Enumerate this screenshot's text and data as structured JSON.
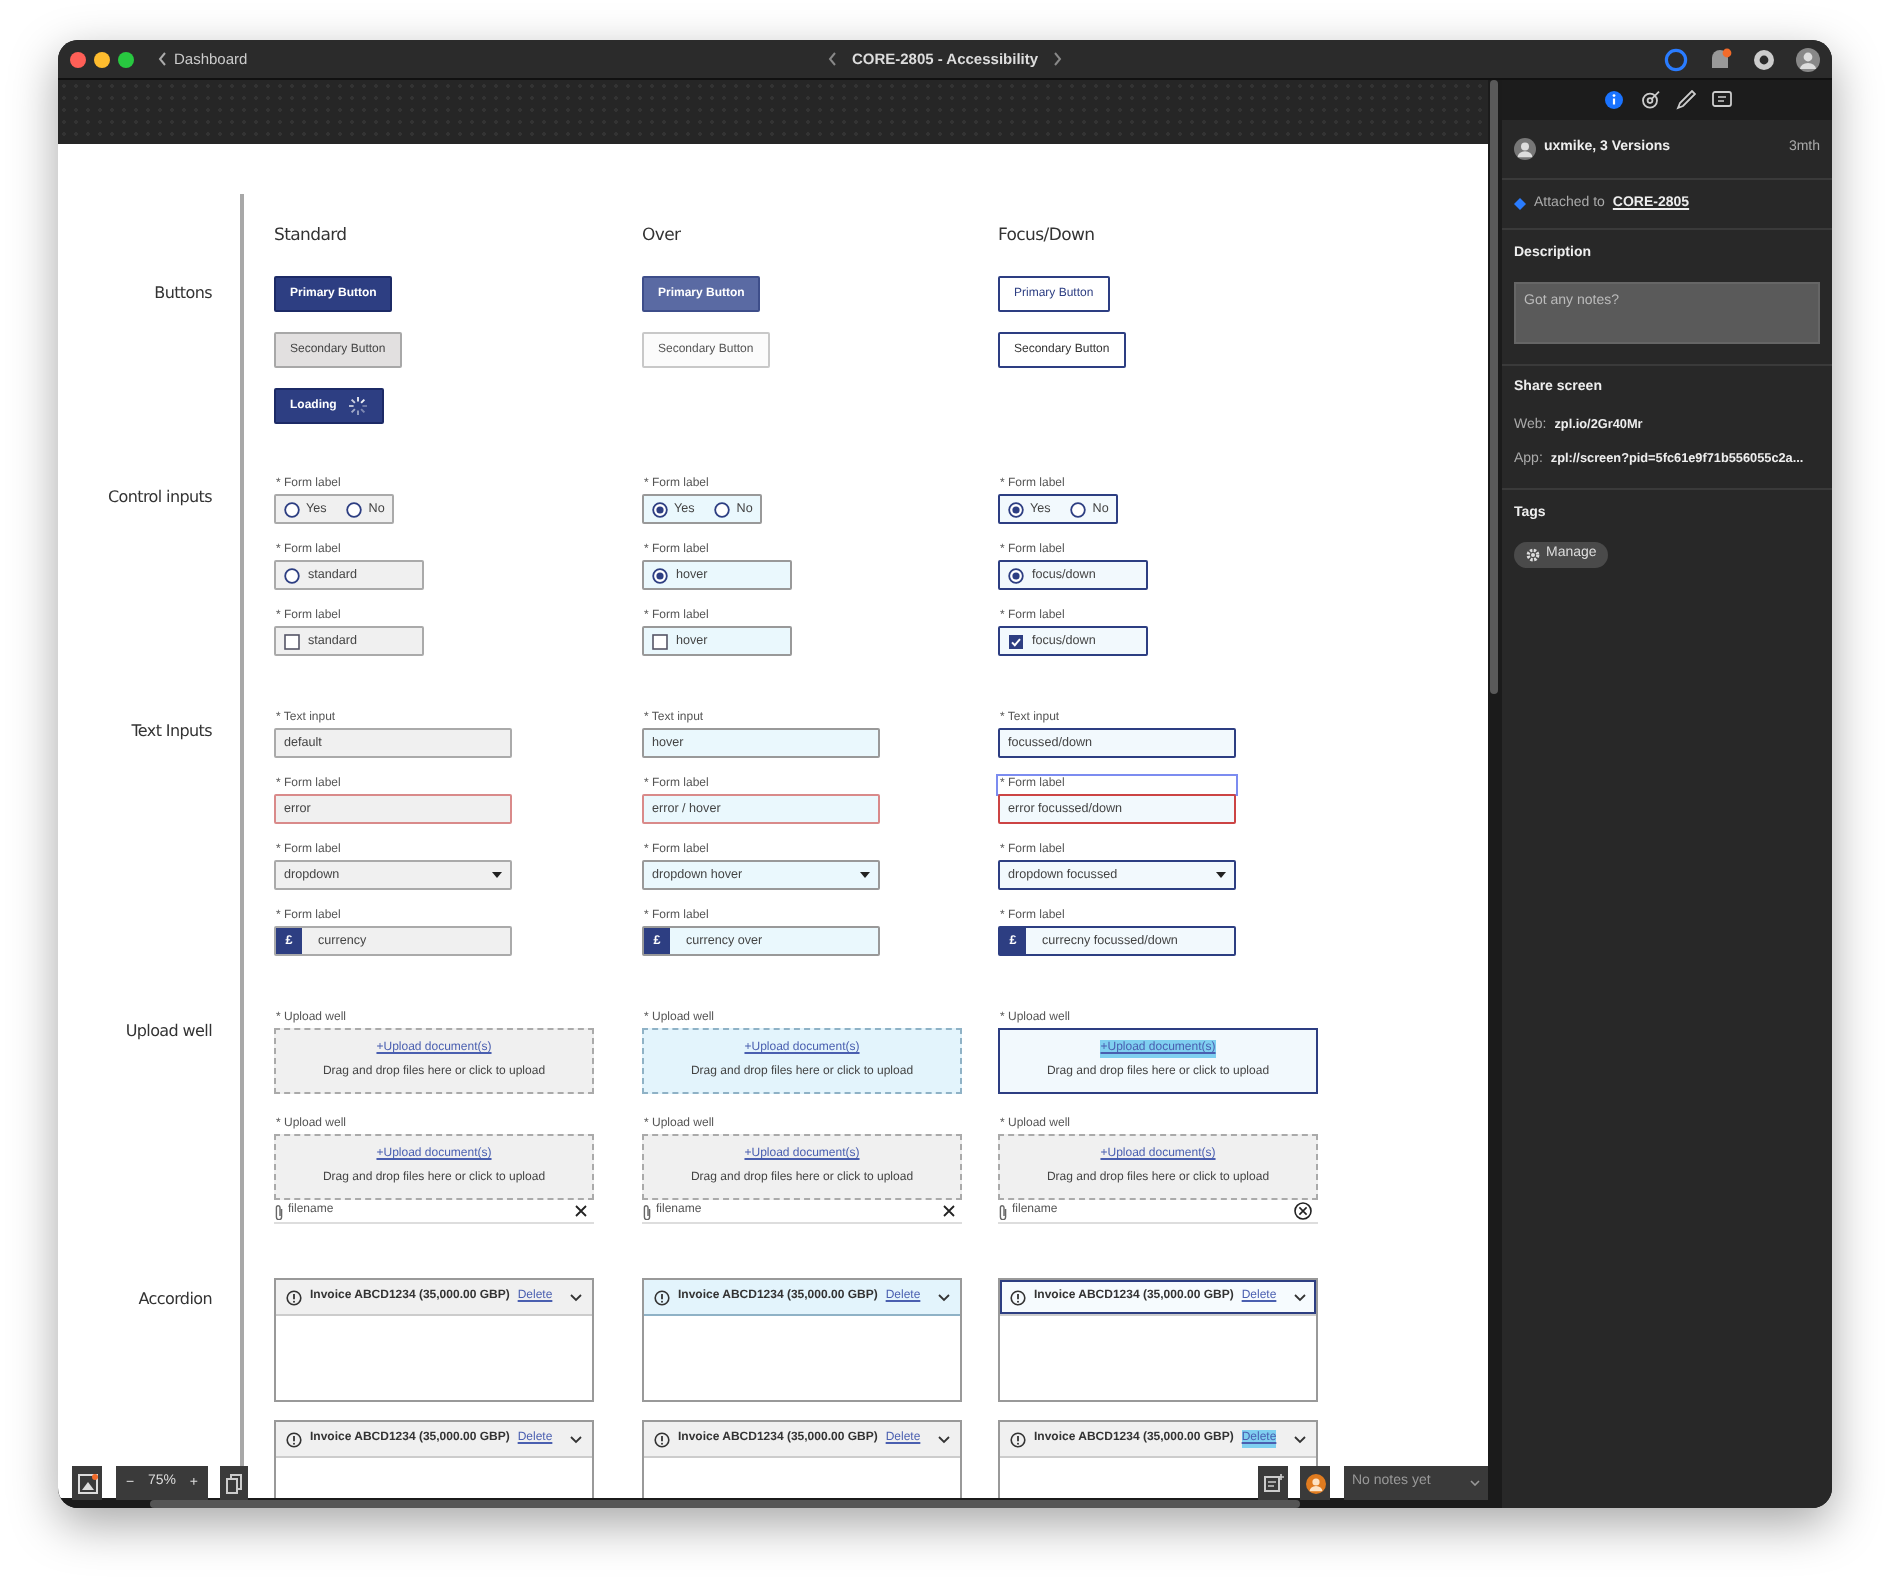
{
  "window": {
    "back_label": "Dashboard",
    "title": "CORE-2805 - Accessibility"
  },
  "columns": [
    "Standard",
    "Over",
    "Focus/Down"
  ],
  "sections": [
    {
      "label": "Buttons",
      "rows": [
        [
          {
            "kind": "primary-button",
            "hovered": false,
            "focused": false,
            "text": "Primary Button"
          },
          {
            "kind": "primary-button",
            "hovered": true,
            "focused": false,
            "text": "Primary Button"
          },
          {
            "kind": "primary-button",
            "hovered": false,
            "focused": true,
            "text": "Primary Button"
          }
        ],
        [
          {
            "kind": "secondary-button",
            "hovered": false,
            "focused": false,
            "text": "Secondary Button"
          },
          {
            "kind": "secondary-button",
            "hovered": true,
            "focused": false,
            "text": "Secondary Button"
          },
          {
            "kind": "secondary-button",
            "hovered": false,
            "focused": true,
            "text": "Secondary Button"
          }
        ],
        [
          {
            "kind": "loading-button",
            "hovered": false,
            "focused": false,
            "text": "Loading"
          }
        ]
      ]
    },
    {
      "label": "Control inputs",
      "rows": [
        [
          {
            "kind": "radio-group",
            "hovered": false,
            "focused": false,
            "label": "* Form label",
            "options": [
              {
                "text": "Yes",
                "selected": false
              },
              {
                "text": "No",
                "selected": false
              }
            ]
          },
          {
            "kind": "radio-group",
            "hovered": true,
            "focused": false,
            "label": "* Form label",
            "options": [
              {
                "text": "Yes",
                "selected": true
              },
              {
                "text": "No",
                "selected": false
              }
            ]
          },
          {
            "kind": "radio-group",
            "hovered": false,
            "focused": true,
            "label": "* Form label",
            "options": [
              {
                "text": "Yes",
                "selected": true
              },
              {
                "text": "No",
                "selected": false
              }
            ]
          }
        ],
        [
          {
            "kind": "radio",
            "hovered": false,
            "focused": false,
            "label": "* Form label",
            "text": "standard",
            "checked": false
          },
          {
            "kind": "radio",
            "hovered": true,
            "focused": false,
            "label": "* Form label",
            "text": "hover",
            "checked": true
          },
          {
            "kind": "radio",
            "hovered": false,
            "focused": true,
            "label": "* Form label",
            "text": "focus/down",
            "checked": true
          }
        ],
        [
          {
            "kind": "checkbox",
            "hovered": false,
            "focused": false,
            "label": "* Form label",
            "text": "standard",
            "checked": false
          },
          {
            "kind": "checkbox",
            "hovered": true,
            "focused": false,
            "label": "* Form label",
            "text": "hover",
            "checked": false
          },
          {
            "kind": "checkbox",
            "hovered": false,
            "focused": true,
            "label": "* Form label",
            "text": "focus/down",
            "checked": true
          }
        ]
      ]
    },
    {
      "label": "Text Inputs",
      "rows": [
        [
          {
            "kind": "text",
            "hovered": false,
            "focused": false,
            "label": "* Text input",
            "value": "default",
            "error": false
          },
          {
            "kind": "text",
            "hovered": true,
            "focused": false,
            "label": "* Text input",
            "value": "hover",
            "error": false
          },
          {
            "kind": "text",
            "hovered": false,
            "focused": true,
            "label": "* Text input",
            "value": "focussed/down",
            "error": false
          }
        ],
        [
          {
            "kind": "text",
            "hovered": false,
            "focused": false,
            "label": "* Form label",
            "value": "error",
            "error": true
          },
          {
            "kind": "text",
            "hovered": true,
            "focused": false,
            "label": "* Form label",
            "value": "error / hover",
            "error": true
          },
          {
            "kind": "text",
            "hovered": false,
            "focused": true,
            "label": "* Form label",
            "value": "error focussed/down",
            "error": true,
            "label_focused": true
          }
        ],
        [
          {
            "kind": "dropdown",
            "hovered": false,
            "focused": false,
            "label": "* Form label",
            "value": "dropdown"
          },
          {
            "kind": "dropdown",
            "hovered": true,
            "focused": false,
            "label": "* Form label",
            "value": "dropdown hover"
          },
          {
            "kind": "dropdown",
            "hovered": false,
            "focused": true,
            "label": "* Form label",
            "value": "dropdown focussed"
          }
        ],
        [
          {
            "kind": "currency",
            "hovered": false,
            "focused": false,
            "label": "* Form label",
            "symbol": "£",
            "value": "currency"
          },
          {
            "kind": "currency",
            "hovered": true,
            "focused": false,
            "label": "* Form label",
            "symbol": "£",
            "value": "currency over"
          },
          {
            "kind": "currency",
            "hovered": false,
            "focused": true,
            "label": "* Form label",
            "symbol": "£",
            "value": "currecny focussed/down"
          }
        ]
      ]
    },
    {
      "label": "Upload well",
      "rows": [
        [
          {
            "kind": "upload",
            "hovered": false,
            "focused": false,
            "label": "* Upload well",
            "link": "+Upload document(s)",
            "hint": "Drag and drop files here or click to upload",
            "link_highlighted": false
          },
          {
            "kind": "upload",
            "hovered": true,
            "focused": false,
            "label": "* Upload well",
            "link": "+Upload document(s)",
            "hint": "Drag and drop files here or click to upload",
            "link_highlighted": false
          },
          {
            "kind": "upload",
            "hovered": false,
            "focused": true,
            "label": "* Upload well",
            "link": "+Upload document(s)",
            "hint": "Drag and drop files here or click to upload",
            "link_highlighted": true
          }
        ],
        [
          {
            "kind": "upload",
            "hovered": false,
            "focused": false,
            "label": "* Upload well",
            "link": "+Upload document(s)",
            "hint": "Drag and drop files here or click to upload",
            "link_highlighted": false,
            "file": {
              "name": "filename",
              "focused": false
            }
          },
          {
            "kind": "upload",
            "hovered": false,
            "focused": false,
            "label": "* Upload well",
            "link": "+Upload document(s)",
            "hint": "Drag and drop files here or click to upload",
            "link_highlighted": false,
            "file": {
              "name": "filename",
              "focused": false
            }
          },
          {
            "kind": "upload",
            "hovered": false,
            "focused": false,
            "label": "* Upload well",
            "link": "+Upload document(s)",
            "hint": "Drag and drop files here or click to upload",
            "link_highlighted": false,
            "file": {
              "name": "filename",
              "focused": true
            }
          }
        ]
      ]
    },
    {
      "label": "Accordion",
      "rows": [
        [
          {
            "kind": "accordion",
            "hovered": false,
            "focused": false,
            "title": "Invoice ABCD1234 (35,000.00 GBP)",
            "link": "Delete",
            "link_highlighted": false
          },
          {
            "kind": "accordion",
            "hovered": true,
            "focused": false,
            "title": "Invoice ABCD1234 (35,000.00 GBP)",
            "link": "Delete",
            "link_highlighted": false
          },
          {
            "kind": "accordion",
            "hovered": false,
            "focused": true,
            "title": "Invoice ABCD1234 (35,000.00 GBP)",
            "link": "Delete",
            "link_highlighted": false
          }
        ],
        [
          {
            "kind": "accordion",
            "hovered": false,
            "focused": false,
            "title": "Invoice ABCD1234 (35,000.00 GBP)",
            "link": "Delete",
            "link_highlighted": false
          },
          {
            "kind": "accordion",
            "hovered": false,
            "focused": false,
            "title": "Invoice ABCD1234 (35,000.00 GBP)",
            "link": "Delete",
            "link_highlighted": false
          },
          {
            "kind": "accordion",
            "hovered": false,
            "focused": false,
            "title": "Invoice ABCD1234 (35,000.00 GBP)",
            "link": "Delete",
            "link_highlighted": true
          }
        ]
      ]
    }
  ],
  "toolbar": {
    "zoom_out": "−",
    "zoom": "75%",
    "zoom_in": "+",
    "notes": "No notes yet"
  },
  "panel": {
    "tabs": [
      {
        "selected": true
      },
      {
        "selected": false
      },
      {
        "selected": false
      },
      {
        "selected": false
      }
    ],
    "author": "uxmike, 3 Versions",
    "age": "3mth",
    "attached_label": "Attached to",
    "attached_link": "CORE-2805",
    "description_title": "Description",
    "description_placeholder": "Got any notes?",
    "share_title": "Share screen",
    "links": [
      {
        "label": "Web:",
        "value": "zpl.io/2Gr40Mr"
      },
      {
        "label": "App:",
        "value": "zpl://screen?pid=5fc61e9f71b556055c2a..."
      }
    ],
    "tags_title": "Tags",
    "manage": "Manage"
  }
}
